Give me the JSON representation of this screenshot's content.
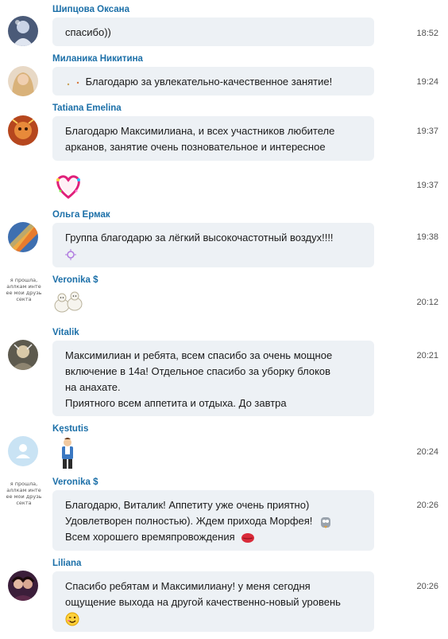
{
  "messages": [
    {
      "sender": "Шипцова Оксана",
      "lines": [
        "спасибо))"
      ],
      "time": "18:52"
    },
    {
      "sender": "Миланика Никитина",
      "lines": [
        "Благодарю за увлекательно-качественное занятие!"
      ],
      "time": "19:24"
    },
    {
      "sender": "Tatiana Emelina",
      "lines": [
        "Благодарю Максимилиана, и всех участников любителе",
        "арканов, занятие очень позновательное и интересное"
      ],
      "time": "19:37"
    },
    {
      "sender": "",
      "sticker": "heart-sticker",
      "time": "19:37"
    },
    {
      "sender": "Ольга Ермак",
      "lines": [
        "Группа благодарю за лёгкий высокочастотный воздух!!!!"
      ],
      "time": "19:38"
    },
    {
      "sender": "Veronika $",
      "sticker": "lambs-sticker",
      "time": "20:12"
    },
    {
      "sender": "Vitalik",
      "lines": [
        "Максимилиан и ребята, всем спасибо за очень мощное",
        "включение в 14а! Отдельное спасибо за уборку блоков",
        "на анахате.",
        "Приятного всем аппетита и отдыха. До завтра"
      ],
      "time": "20:21"
    },
    {
      "sender": "Kęstutis",
      "sticker": "man-sticker",
      "time": "20:24"
    },
    {
      "sender": "Veronika $",
      "lines": [
        "Благодарю, Виталик! Аппетиту уже очень приятно)",
        "Удовлетворен полностью).  Ждем прихода Морфея!",
        "Всем хорошего времяпровождения"
      ],
      "time": "20:26"
    },
    {
      "sender": "Liliana",
      "lines": [
        "Спасибо ребятам и Максимилиану! у меня сегодня",
        "ощущение выхода на другой качественно-новый уровень"
      ],
      "time": "20:26"
    }
  ],
  "avatar_text": {
    "line1": "я прошла,",
    "line2": "аллкам инте",
    "line3": "ее мои друзь",
    "line4": "секта"
  },
  "colors": {
    "sender": "#1b6fa8",
    "bubble": "#edf1f5",
    "time": "#505050"
  }
}
